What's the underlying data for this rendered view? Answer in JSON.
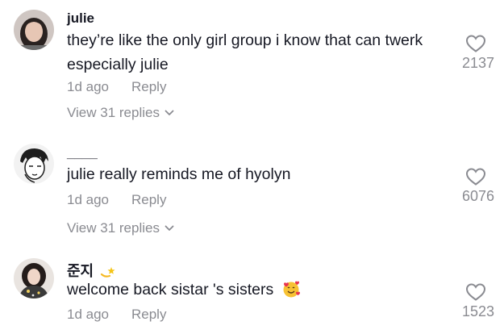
{
  "comments": [
    {
      "username": "julie",
      "text": "they’re like the only girl group i know that can twerk especially julie",
      "time": "1d ago",
      "reply_label": "Reply",
      "replies_label": "View 31 replies",
      "likes": "2137"
    },
    {
      "username": "____",
      "text": "julie really reminds me of hyolyn",
      "time": "1d ago",
      "reply_label": "Reply",
      "replies_label": "View 31 replies",
      "likes": "6076"
    },
    {
      "username": "준지",
      "username_emoji": "dizzy-star-emoji",
      "text": "welcome back sistar 's sisters",
      "text_emoji": "smiling-face-with-hearts-emoji",
      "time": "1d ago",
      "reply_label": "Reply",
      "likes": "1523"
    }
  ],
  "colors": {
    "text": "#161823",
    "muted": "#8a8b91"
  },
  "icons": {
    "like": "heart-outline-icon",
    "expand": "chevron-down-icon"
  }
}
